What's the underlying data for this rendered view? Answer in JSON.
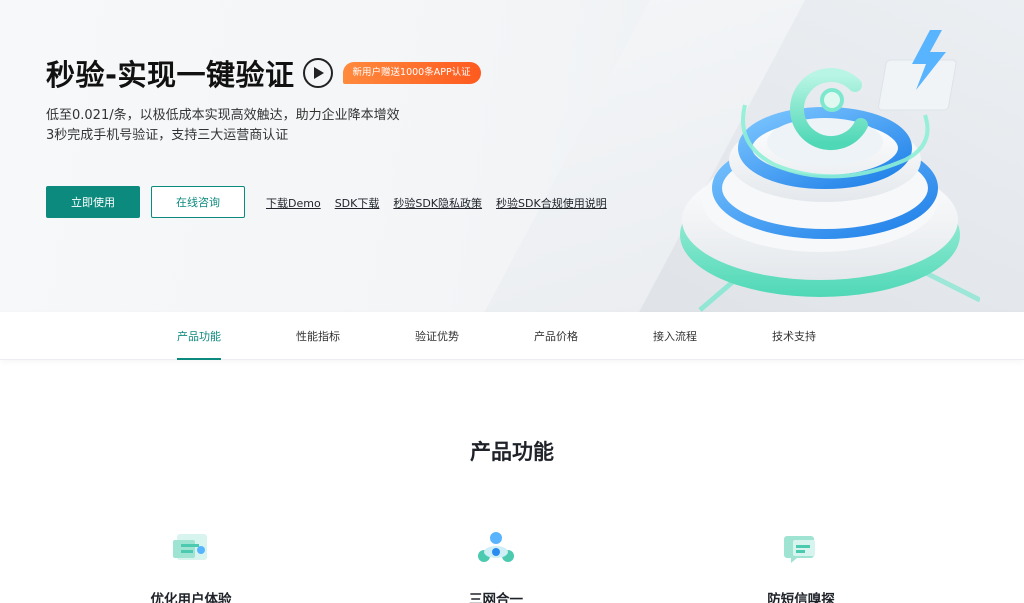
{
  "hero": {
    "title": "秒验-实现一键验证",
    "promo_badge": "新用户赠送1000条APP认证",
    "subtitle_line1": "低至0.021/条，以极低成本实现高效触达，助力企业降本增效",
    "subtitle_line2": "3秒完成手机号验证，支持三大运营商认证",
    "primary_button": "立即使用",
    "secondary_button": "在线咨询",
    "links": [
      "下载Demo",
      "SDK下载",
      "秒验SDK隐私政策",
      "秒验SDK合规使用说明"
    ],
    "play_icon": "play-circle-icon"
  },
  "tabs": [
    {
      "label": "产品功能",
      "active": true
    },
    {
      "label": "性能指标",
      "active": false
    },
    {
      "label": "验证优势",
      "active": false
    },
    {
      "label": "产品价格",
      "active": false
    },
    {
      "label": "接入流程",
      "active": false
    },
    {
      "label": "技术支持",
      "active": false
    }
  ],
  "section": {
    "title": "产品功能"
  },
  "features": [
    {
      "name": "优化用户体验",
      "icon": "user-experience-icon"
    },
    {
      "name": "三网合一",
      "icon": "network-merge-icon"
    },
    {
      "name": "防短信嗅探",
      "icon": "sms-shield-icon"
    }
  ],
  "colors": {
    "accent": "#0d8a7e",
    "promo": "#ff6a2a",
    "illustration_teal": "#5fe0c0",
    "illustration_blue": "#2a8cf0"
  }
}
